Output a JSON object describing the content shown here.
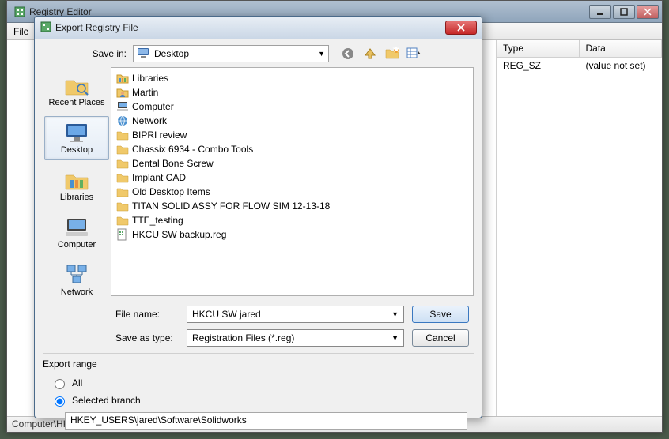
{
  "main": {
    "title": "Registry Editor",
    "menu": {
      "file": "File"
    },
    "columns": {
      "type": "Type",
      "data": "Data"
    },
    "row": {
      "type": "REG_SZ",
      "data": "(value not set)"
    },
    "status": "Computer\\HKEY_USERS\\jared\\Software\\Solidworks"
  },
  "dialog": {
    "title": "Export Registry File",
    "savein_label": "Save in:",
    "savein_value": "Desktop",
    "places": [
      {
        "key": "recent",
        "label": "Recent Places"
      },
      {
        "key": "desktop",
        "label": "Desktop"
      },
      {
        "key": "libraries",
        "label": "Libraries"
      },
      {
        "key": "computer",
        "label": "Computer"
      },
      {
        "key": "network",
        "label": "Network"
      }
    ],
    "files": [
      {
        "icon": "libraries",
        "name": "Libraries"
      },
      {
        "icon": "user",
        "name": "Martin"
      },
      {
        "icon": "computer",
        "name": "Computer"
      },
      {
        "icon": "network",
        "name": "Network"
      },
      {
        "icon": "folder",
        "name": "BIPRI review"
      },
      {
        "icon": "folder",
        "name": "Chassix 6934 - Combo Tools"
      },
      {
        "icon": "folder",
        "name": "Dental Bone Screw"
      },
      {
        "icon": "folder",
        "name": "Implant CAD"
      },
      {
        "icon": "folder",
        "name": "Old Desktop Items"
      },
      {
        "icon": "folder",
        "name": "TITAN SOLID ASSY FOR FLOW SIM 12-13-18"
      },
      {
        "icon": "folder",
        "name": "TTE_testing"
      },
      {
        "icon": "regfile",
        "name": "HKCU SW backup.reg"
      }
    ],
    "filename_label": "File name:",
    "filename_value": "HKCU SW jared",
    "savetype_label": "Save as type:",
    "savetype_value": "Registration Files (*.reg)",
    "save_btn": "Save",
    "cancel_btn": "Cancel",
    "export_range_label": "Export range",
    "radio_all": "All",
    "radio_selected": "Selected branch",
    "branch_value": "HKEY_USERS\\jared\\Software\\Solidworks"
  }
}
